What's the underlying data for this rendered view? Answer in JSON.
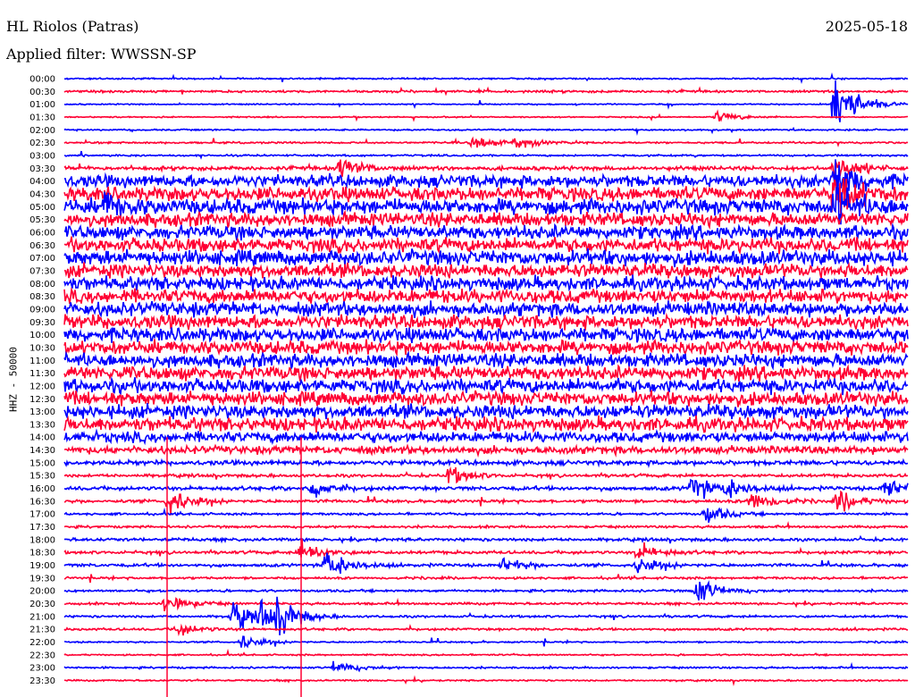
{
  "header": {
    "station": "HL Riolos (Patras)",
    "date": "2025-05-18",
    "filter": "Applied filter: WWSSN-SP"
  },
  "chart_data": {
    "type": "line",
    "title": "HL Riolos (Patras)",
    "ylabel": "HHZ - 50000",
    "minutes_per_line": 30,
    "colors": {
      "even": "#0000ff",
      "odd": "#ff0033"
    },
    "row_labels": [
      "00:00",
      "00:30",
      "01:00",
      "01:30",
      "02:00",
      "02:30",
      "03:00",
      "03:30",
      "04:00",
      "04:30",
      "05:00",
      "05:30",
      "06:00",
      "06:30",
      "07:00",
      "07:30",
      "08:00",
      "08:30",
      "09:00",
      "09:30",
      "10:00",
      "10:30",
      "11:00",
      "11:30",
      "12:00",
      "12:30",
      "13:00",
      "13:30",
      "14:00",
      "14:30",
      "15:00",
      "15:30",
      "16:00",
      "16:30",
      "17:00",
      "17:30",
      "18:00",
      "18:30",
      "19:00",
      "19:30",
      "20:00",
      "20:30",
      "21:00",
      "21:30",
      "22:00",
      "22:30",
      "23:00",
      "23:30"
    ],
    "noise_level": [
      1,
      1.5,
      0.8,
      0.8,
      1,
      1.2,
      1.2,
      2.5,
      8,
      9,
      10,
      9,
      9,
      9,
      10,
      9,
      9,
      9,
      9,
      9,
      9,
      9,
      9,
      9,
      9,
      9,
      9,
      9,
      7,
      5,
      3,
      2,
      2.5,
      2,
      1.5,
      1.5,
      2,
      2,
      2,
      1.5,
      1.5,
      1.5,
      1.5,
      1.5,
      1,
      1,
      1.2,
      1
    ],
    "events": [
      {
        "row": 3,
        "minute": 23.2,
        "amp": 5
      },
      {
        "row": 5,
        "minute": 14.5,
        "amp": 6
      },
      {
        "row": 5,
        "minute": 16,
        "amp": 5
      },
      {
        "row": 2,
        "minute": 27.4,
        "amp": 30
      },
      {
        "row": 7,
        "minute": 27.4,
        "amp": 12
      },
      {
        "row": 8,
        "minute": 27.4,
        "amp": 20
      },
      {
        "row": 9,
        "minute": 27.4,
        "amp": 20
      },
      {
        "row": 10,
        "minute": 27.4,
        "amp": 18
      },
      {
        "row": 7,
        "minute": 9.8,
        "amp": 10
      },
      {
        "row": 10,
        "minute": 1.4,
        "amp": 10
      },
      {
        "row": 31,
        "minute": 13.7,
        "amp": 8
      },
      {
        "row": 32,
        "minute": 8.8,
        "amp": 8
      },
      {
        "row": 32,
        "minute": 22.3,
        "amp": 12
      },
      {
        "row": 32,
        "minute": 23.5,
        "amp": 9
      },
      {
        "row": 32,
        "minute": 29.2,
        "amp": 9
      },
      {
        "row": 33,
        "minute": 3.7,
        "amp": 12
      },
      {
        "row": 33,
        "minute": 24.4,
        "amp": 10
      },
      {
        "row": 33,
        "minute": 27.5,
        "amp": 10
      },
      {
        "row": 34,
        "minute": 22.8,
        "amp": 8
      },
      {
        "row": 37,
        "minute": 8.4,
        "amp": 10
      },
      {
        "row": 37,
        "minute": 20.4,
        "amp": 8
      },
      {
        "row": 38,
        "minute": 9.3,
        "amp": 16
      },
      {
        "row": 38,
        "minute": 15.6,
        "amp": 6
      },
      {
        "row": 38,
        "minute": 20.4,
        "amp": 7
      },
      {
        "row": 40,
        "minute": 22.5,
        "amp": 12
      },
      {
        "row": 41,
        "minute": 3.6,
        "amp": 9
      },
      {
        "row": 42,
        "minute": 6,
        "amp": 12
      },
      {
        "row": 42,
        "minute": 7,
        "amp": 10
      },
      {
        "row": 42,
        "minute": 7.6,
        "amp": 14
      },
      {
        "row": 43,
        "minute": 4,
        "amp": 6
      },
      {
        "row": 44,
        "minute": 6.3,
        "amp": 6
      },
      {
        "row": 46,
        "minute": 9.6,
        "amp": 6
      }
    ]
  }
}
